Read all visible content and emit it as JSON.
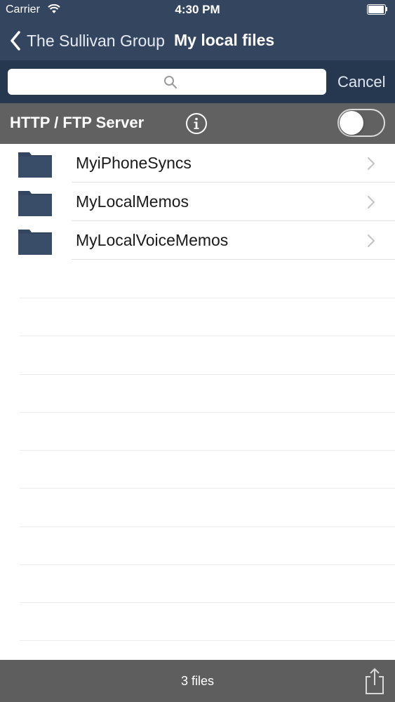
{
  "status_bar": {
    "carrier": "Carrier",
    "time": "4:30 PM",
    "wifi_icon": "wifi-icon",
    "battery_icon": "battery-icon"
  },
  "nav": {
    "back_label": "The Sullivan Group",
    "title": "My local files",
    "back_icon": "chevron-left-icon"
  },
  "search": {
    "value": "",
    "placeholder": "",
    "cancel_label": "Cancel",
    "icon": "search-icon"
  },
  "server": {
    "label": "HTTP / FTP Server",
    "info_icon": "info-icon",
    "toggle_on": false
  },
  "files": [
    {
      "name": "MyiPhoneSyncs",
      "icon": "folder-icon"
    },
    {
      "name": "MyLocalMemos",
      "icon": "folder-icon"
    },
    {
      "name": "MyLocalVoiceMemos",
      "icon": "folder-icon"
    }
  ],
  "footer": {
    "count_label": "3 files",
    "share_icon": "share-icon"
  },
  "colors": {
    "nav_background": "#34465f",
    "search_background": "#253850",
    "server_row_background": "#616161",
    "folder": "#34465f",
    "toolbar_background": "#5e5e5e"
  }
}
